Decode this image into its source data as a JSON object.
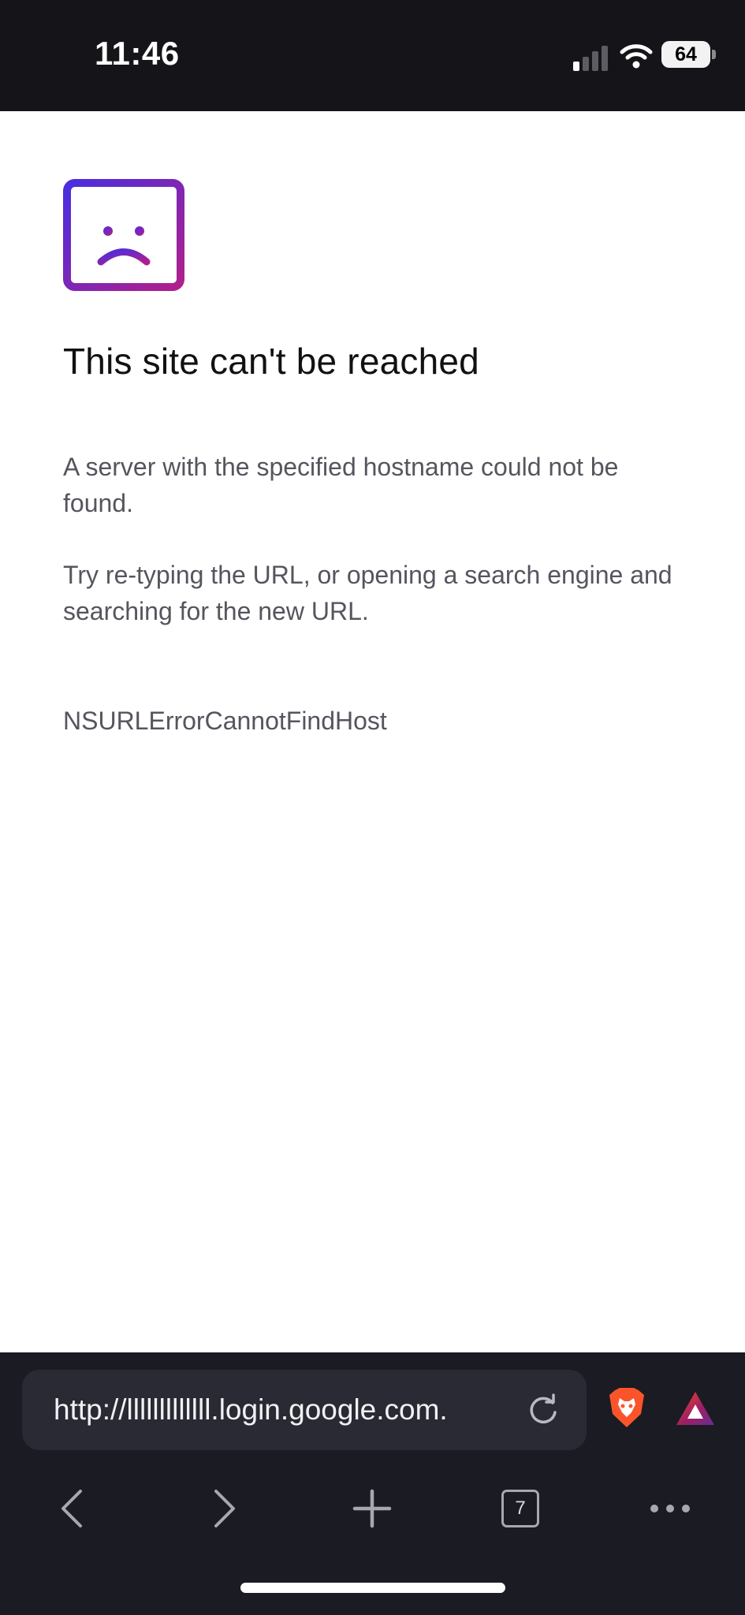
{
  "status_bar": {
    "time": "11:46",
    "battery_level": "64",
    "icons": [
      "signal-icon",
      "wifi-icon",
      "battery-icon"
    ]
  },
  "error_page": {
    "icon": "sad-browser-icon",
    "title": "This site can't be reached",
    "description": "A server with the specified hostname could not be found.",
    "suggestion": "Try re-typing the URL, or opening a search engine and searching for the new URL.",
    "error_code": "NSURLErrorCannotFindHost"
  },
  "toolbar": {
    "url": "http://lllllllllllll.login.google.com.",
    "icons": [
      "reload-icon",
      "brave-shields-icon",
      "brave-rewards-icon"
    ],
    "nav": {
      "back_icon": "chevron-left-icon",
      "forward_icon": "chevron-right-icon",
      "new_tab_icon": "plus-icon",
      "tab_count": "7",
      "menu_icon": "more-icon"
    }
  },
  "colors": {
    "bar_background": "#141419",
    "toolbar_background": "#1b1b23",
    "accent_gradient_start": "#4a2ee0",
    "accent_gradient_end": "#b01f8c",
    "brave_orange": "#fb542b"
  }
}
